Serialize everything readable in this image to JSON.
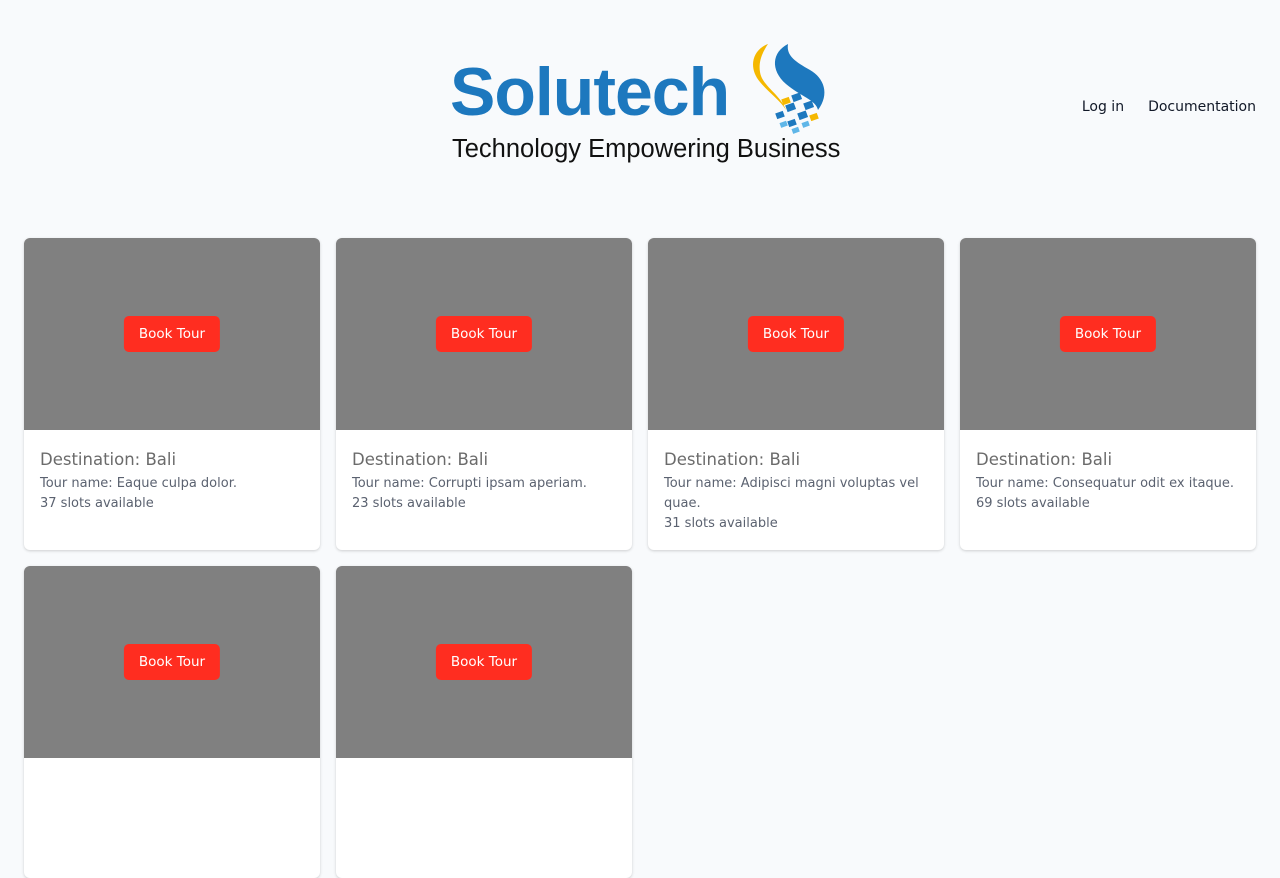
{
  "brand": {
    "name": "Solutech",
    "tagline": "Technology Empowering Business",
    "color": "#1d78be"
  },
  "nav": {
    "login": "Log in",
    "documentation": "Documentation"
  },
  "tours": [
    {
      "button": "Book Tour",
      "destination": "Destination: Bali",
      "tour_name": "Tour name: Eaque culpa dolor.",
      "slots": "37 slots available"
    },
    {
      "button": "Book Tour",
      "destination": "Destination: Bali",
      "tour_name": "Tour name: Corrupti ipsam aperiam.",
      "slots": "23 slots available"
    },
    {
      "button": "Book Tour",
      "destination": "Destination: Bali",
      "tour_name": "Tour name: Adipisci magni voluptas vel quae.",
      "slots": "31 slots available"
    },
    {
      "button": "Book Tour",
      "destination": "Destination: Bali",
      "tour_name": "Tour name: Consequatur odit ex itaque.",
      "slots": "69 slots available"
    },
    {
      "button": "Book Tour"
    },
    {
      "button": "Book Tour"
    }
  ],
  "colors": {
    "button": "#ff2d20",
    "image_placeholder": "#808080",
    "background": "#f8fafc"
  }
}
